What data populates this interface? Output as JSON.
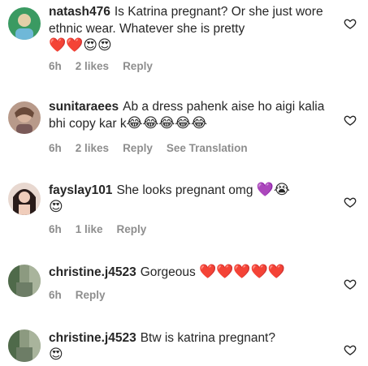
{
  "comments": [
    {
      "username": "natash476",
      "text": "Is Katrina pregnant? Or she just wore ethnic wear. Whatever she is pretty",
      "emojis": "❤️❤️😍😍",
      "time": "6h",
      "likes": "2 likes",
      "reply": "Reply",
      "avatar_colors": [
        "#2e8b57",
        "#e0c8a0"
      ]
    },
    {
      "username": "sunitaraees",
      "text": "Ab a dress pahenk aise ho aigi kalia bhi copy kar k",
      "emojis": "😂😂😂😂😂",
      "time": "6h",
      "likes": "2 likes",
      "reply": "Reply",
      "translate": "See Translation",
      "avatar_colors": [
        "#8a6a5a",
        "#d9b6a0"
      ]
    },
    {
      "username": "fayslay101",
      "text": "She looks pregnant omg",
      "emojis": "💜😭",
      "emojis_line2": "😍",
      "time": "6h",
      "likes": "1 like",
      "reply": "Reply",
      "avatar_colors": [
        "#3a2a2a",
        "#e6c2b0"
      ]
    },
    {
      "username": "christine.j4523",
      "text": "Gorgeous",
      "emojis": "❤️❤️❤️❤️❤️",
      "time": "6h",
      "reply": "Reply",
      "avatar_colors": [
        "#5f7a5a",
        "#9aa78e"
      ]
    },
    {
      "username": "christine.j4523",
      "text": "Btw is katrina pregnant?",
      "emojis_line2": "😍",
      "avatar_colors": [
        "#5f7a5a",
        "#9aa78e"
      ]
    }
  ],
  "icons": {
    "like": "heart-outline-icon"
  }
}
